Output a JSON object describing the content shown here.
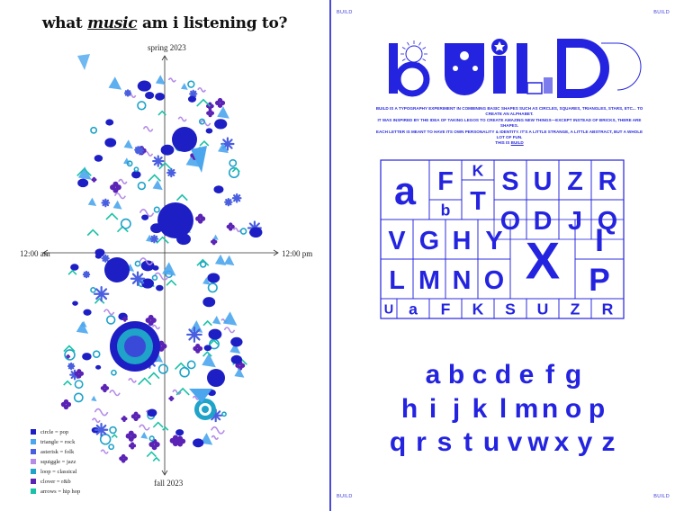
{
  "left_page": {
    "title_pre": "what",
    "title_em": "music",
    "title_post": "am i listening to?",
    "axis": {
      "top": "spring 2023",
      "bottom": "fall 2023",
      "left": "12:00 am",
      "right": "12:00 pm"
    },
    "legend": [
      {
        "label": "circle = pop",
        "color": "#1d1fc4"
      },
      {
        "label": "triangle = rock",
        "color": "#4ba6ee"
      },
      {
        "label": "asterisk = folk",
        "color": "#4a5fe0"
      },
      {
        "label": "squiggle = jazz",
        "color": "#b58ce8"
      },
      {
        "label": "loop = classical",
        "color": "#1fa3c9"
      },
      {
        "label": "clover = r&b",
        "color": "#5a22b5"
      },
      {
        "label": "arrows = hip hop",
        "color": "#19c2a6"
      }
    ]
  },
  "right_page": {
    "corner_label": "BUILD",
    "wordmark": "BUILD",
    "intro_lines": [
      "BUILD IS A TYPOGRAPHY EXPERIMENT IN COMBINING BASIC SHAPES SUCH AS CIRCLES, SQUARES, TRIANGLES, STARS, ETC... TO CREATE AN ALPHABET.",
      "IT WAS INSPIRED BY THE IDEA OF TAKING LEGOS TO CREATE AMAZING NEW THINGS—EXCEPT INSTEAD OF BRICKS, THERE ARE SHAPES.",
      "EACH LETTER IS MEANT TO HAVE ITS OWN PERSONALITY & IDENTITY. IT'S A LITTLE STRANGE, A LITTLE ABSTRACT, BUT A WHOLE LOT OF FUN."
    ],
    "intro_last_prefix": "THIS IS",
    "intro_last_link": "BUILD",
    "grid_letters": [
      "a",
      "F",
      "K",
      "S",
      "U",
      "Z",
      "R",
      "T",
      "b",
      "O",
      "D",
      "J",
      "Q",
      "V",
      "G",
      "H",
      "Y",
      "X",
      "I",
      "L",
      "M",
      "N",
      "O",
      "P",
      "U"
    ],
    "alphabet_rows": [
      "abcdefg",
      "hijklmnop",
      "qrstuvwxyz"
    ],
    "accent_color": "#2424e0"
  }
}
